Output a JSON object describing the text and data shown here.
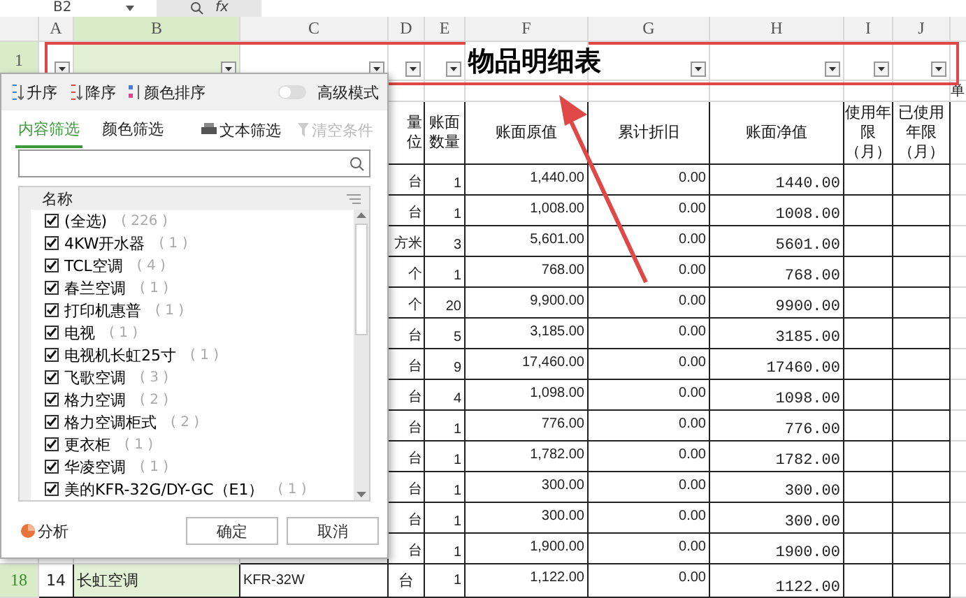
{
  "formula_bar": {
    "cell_ref": "B2",
    "function_label": "fx"
  },
  "columns": [
    "A",
    "B",
    "C",
    "D",
    "E",
    "F",
    "G",
    "H",
    "I",
    "J"
  ],
  "title_row": {
    "row_number": "1",
    "title": "物品明细表"
  },
  "row_2": {
    "column_k": "单"
  },
  "header": {
    "unit": "量位",
    "quantity": "账面数量",
    "original_value": "账面原值",
    "depreciation": "累计折旧",
    "net_value": "账面净值",
    "service_life": "使用年限（月）",
    "used_life": "已使用年限（月）"
  },
  "rows": [
    {
      "unit": "台",
      "quantity": "1",
      "original_value": "1,440.00",
      "depreciation": "0.00",
      "net_value": "1440.00"
    },
    {
      "unit": "台",
      "quantity": "1",
      "original_value": "1,008.00",
      "depreciation": "0.00",
      "net_value": "1008.00"
    },
    {
      "unit": "方米",
      "quantity": "3",
      "original_value": "5,601.00",
      "depreciation": "0.00",
      "net_value": "5601.00"
    },
    {
      "unit": "个",
      "quantity": "1",
      "original_value": "768.00",
      "depreciation": "0.00",
      "net_value": "768.00"
    },
    {
      "unit": "个",
      "quantity": "20",
      "original_value": "9,900.00",
      "depreciation": "0.00",
      "net_value": "9900.00"
    },
    {
      "unit": "台",
      "quantity": "5",
      "original_value": "3,185.00",
      "depreciation": "0.00",
      "net_value": "3185.00"
    },
    {
      "unit": "台",
      "quantity": "9",
      "original_value": "17,460.00",
      "depreciation": "0.00",
      "net_value": "17460.00"
    },
    {
      "unit": "台",
      "quantity": "4",
      "original_value": "1,098.00",
      "depreciation": "0.00",
      "net_value": "1098.00"
    },
    {
      "unit": "台",
      "quantity": "1",
      "original_value": "776.00",
      "depreciation": "0.00",
      "net_value": "776.00"
    },
    {
      "unit": "台",
      "quantity": "1",
      "original_value": "1,782.00",
      "depreciation": "0.00",
      "net_value": "1782.00"
    },
    {
      "unit": "台",
      "quantity": "1",
      "original_value": "300.00",
      "depreciation": "0.00",
      "net_value": "300.00"
    },
    {
      "unit": "台",
      "quantity": "1",
      "original_value": "300.00",
      "depreciation": "0.00",
      "net_value": "300.00"
    },
    {
      "unit": "台",
      "quantity": "1",
      "original_value": "1,900.00",
      "depreciation": "0.00",
      "net_value": "1900.00"
    }
  ],
  "last_row": {
    "row_number": "18",
    "index": "14",
    "name": "长虹空调",
    "model": "KFR-32W",
    "unit": "台",
    "quantity": "1",
    "original_value": "1,122.00",
    "depreciation": "0.00",
    "net_value": "1122.00"
  },
  "filter_popup": {
    "sort_buttons": [
      "升序",
      "降序",
      "颜色排序"
    ],
    "advanced_mode": {
      "label": "高级模式",
      "on": false
    },
    "tabs": [
      {
        "label": "内容筛选",
        "selected": true
      },
      {
        "label": "颜色筛选",
        "selected": false
      }
    ],
    "text_filter": "文本筛选",
    "clear": {
      "label": "清空条件",
      "disabled": true
    },
    "list_header": "名称",
    "items": [
      {
        "label": "(全选)",
        "count": "( 226 )",
        "checked": true
      },
      {
        "label": "4KW开水器",
        "count": "( 1 )",
        "checked": true
      },
      {
        "label": "TCL空调",
        "count": "( 4 )",
        "checked": true
      },
      {
        "label": "春兰空调",
        "count": "( 1 )",
        "checked": true
      },
      {
        "label": "打印机惠普",
        "count": "( 1 )",
        "checked": true
      },
      {
        "label": "电视",
        "count": "( 1 )",
        "checked": true
      },
      {
        "label": "电视机长虹25寸",
        "count": "( 1 )",
        "checked": true
      },
      {
        "label": "飞歌空调",
        "count": "( 3 )",
        "checked": true
      },
      {
        "label": "格力空调",
        "count": "( 2 )",
        "checked": true
      },
      {
        "label": "格力空调柜式",
        "count": "( 2 )",
        "checked": true
      },
      {
        "label": "更衣柜",
        "count": "( 1 )",
        "checked": true
      },
      {
        "label": "华凌空调",
        "count": "( 1 )",
        "checked": true
      },
      {
        "label": "美的KFR-32G/DY-GC（E1）",
        "count": "( 1 )",
        "checked": true
      }
    ],
    "analyze": "分析",
    "buttons": [
      "确定",
      "取消"
    ]
  }
}
